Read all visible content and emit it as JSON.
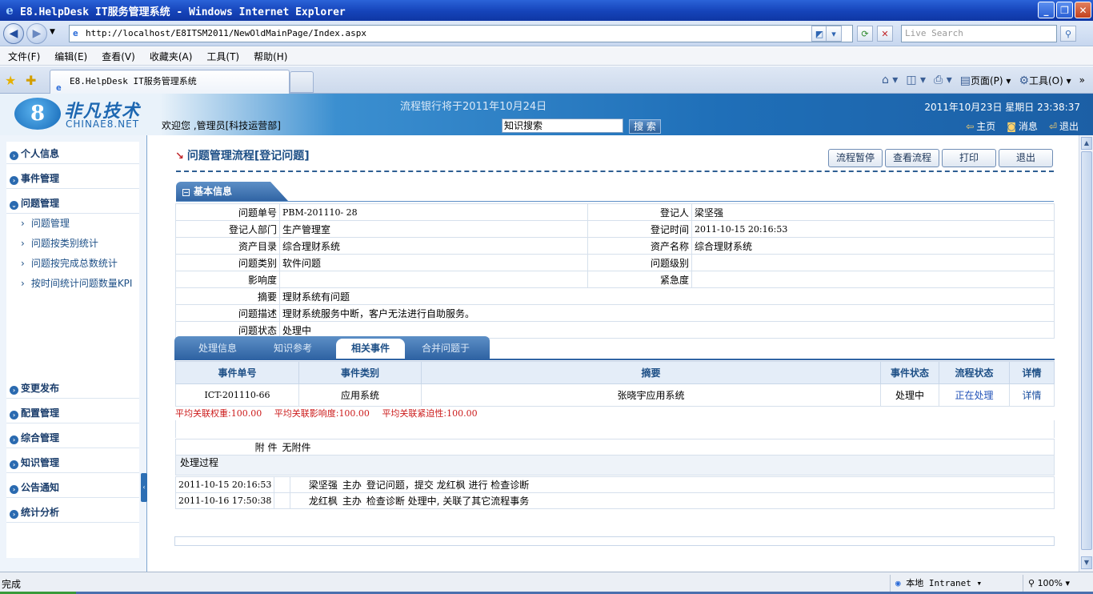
{
  "browser": {
    "title": "E8.HelpDesk IT服务管理系统 - Windows Internet Explorer",
    "url": "http://localhost/E8ITSM2011/NewOldMainPage/Index.aspx",
    "search_placeholder": "Live Search",
    "menu": [
      "文件(F)",
      "编辑(E)",
      "查看(V)",
      "收藏夹(A)",
      "工具(T)",
      "帮助(H)"
    ],
    "tab_label": "E8.HelpDesk IT服务管理系统",
    "cmd_page": "页面(P)",
    "cmd_tools": "工具(O)",
    "status_text": "完成",
    "zone_text": "本地 Intranet",
    "zoom_text": "100%"
  },
  "header": {
    "logo_cn": "非凡技术",
    "logo_en": "CHINAE8.NET",
    "welcome": "欢迎您 ,管理员[科技运营部]",
    "notice": "流程银行将于2011年10月24日",
    "kb_value": "知识搜索",
    "kb_button": "搜 索",
    "datetime": "2011年10月23日  星期日  23:38:37",
    "link_home": "主页",
    "link_msg": "消息",
    "link_exit": "退出"
  },
  "sidebar": {
    "heads_top": [
      "个人信息",
      "事件管理",
      "问题管理"
    ],
    "subitems": [
      "问题管理",
      "问题按类别统计",
      "问题按完成总数统计",
      "按时间统计问题数量KPI"
    ],
    "heads_bottom": [
      "变更发布",
      "配置管理",
      "综合管理",
      "知识管理",
      "公告通知",
      "统计分析"
    ]
  },
  "main": {
    "page_title": "问题管理流程[登记问题]",
    "buttons": [
      "流程暂停",
      "查看流程",
      "打印",
      "退出"
    ],
    "section_label": "基本信息",
    "info": {
      "l_no": "问题单号",
      "v_no": "PBM-201110- 28",
      "l_reg": "登记人",
      "v_reg": "梁坚强",
      "l_dept": "登记人部门",
      "v_dept": "生产管理室",
      "l_time": "登记时间",
      "v_time": "2011-10-15 20:16:53",
      "l_asset_dir": "资产目录",
      "v_asset_dir": "综合理财系统",
      "l_asset_name": "资产名称",
      "v_asset_name": "综合理财系统",
      "l_type": "问题类别",
      "v_type": "软件问题",
      "l_level": "问题级别",
      "v_level": "",
      "l_impact": "影响度",
      "v_impact": "",
      "l_urgency": "紧急度",
      "v_urgency": "",
      "l_summary": "摘要",
      "v_summary": "理财系统有问题",
      "l_desc": "问题描述",
      "v_desc": "理财系统服务中断，客户无法进行自助服务。",
      "l_status": "问题状态",
      "v_status": "处理中"
    },
    "subtabs": [
      "处理信息",
      "知识参考",
      "相关事件",
      "合并问题于"
    ],
    "events_headers": [
      "事件单号",
      "事件类别",
      "摘要",
      "事件状态",
      "流程状态",
      "详情"
    ],
    "events_rows": [
      [
        "ICT-201110-66",
        "应用系统",
        "张晓宇应用系统",
        "处理中",
        "正在处理",
        "详情"
      ]
    ],
    "avg": {
      "weight_label": "平均关联权重:",
      "weight_value": "100.00",
      "impact_label": "平均关联影响度:",
      "impact_value": "100.00",
      "urgency_label": "平均关联紧迫性:",
      "urgency_value": "100.00"
    },
    "attach_label": "附 件",
    "attach_value": "无附件",
    "process_label": "处理过程",
    "process_rows": [
      {
        "time": "2011-10-15 20:16:53",
        "person": "梁坚强",
        "role": "主办",
        "action": "登记问题，提交 龙红枫 进行 检查诊断"
      },
      {
        "time": "2011-10-16 17:50:38",
        "person": "龙红枫",
        "role": "主办",
        "action": "检查诊断 处理中, 关联了其它流程事务"
      }
    ]
  }
}
